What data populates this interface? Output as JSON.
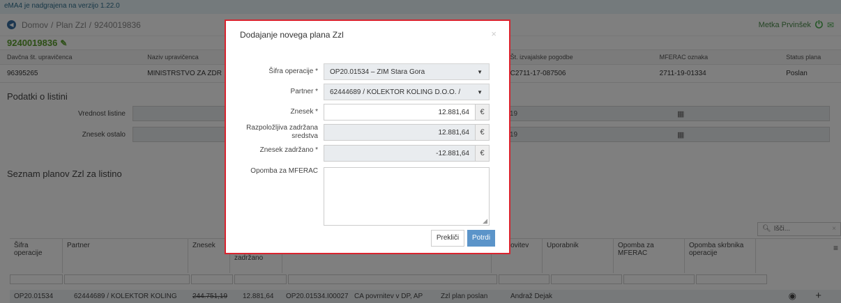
{
  "notice": "eMA4 je nadgrajena na verzijo 1.22.0",
  "breadcrumb": {
    "home": "Domov",
    "sep": "/",
    "plan": "Plan Zzl",
    "id": "9240019836"
  },
  "user": {
    "name": "Metka Prvinšek"
  },
  "document": {
    "number": "9240019836"
  },
  "info": {
    "headers": [
      "Davčna št. upravičenca",
      "Naziv upravičenca",
      "Št. izvajalske pogodbe",
      "MFERAC oznaka",
      "Status plana"
    ],
    "values": [
      "96395265",
      "MINISTRSTVO ZA ZDR",
      "C2711-17-087506",
      "2711-19-01334",
      "Poslan"
    ]
  },
  "listina": {
    "title": "Podatki o listini",
    "vrednost_label": "Vrednost listine",
    "ostalo_label": "Znesek ostalo",
    "partial_1": "19",
    "partial_2": "19"
  },
  "list": {
    "title": "Seznam planov Zzl za listino",
    "search_placeholder": "Išči...",
    "headers": [
      "Šifra operacije",
      "Partner",
      "Znesek",
      "zadržano",
      "Ugotovitev",
      "Uporabnik",
      "Opomba za MFERAC",
      "Opomba skrbnika operacije"
    ],
    "row": {
      "sifra": "OP20.01534",
      "partner": "62444689 / KOLEKTOR KOLING",
      "znesek": "244.751,19",
      "zadrzano": "12.881,64",
      "op": "OP20.01534.I00027",
      "vrsta": "CA povrnitev v DP, AP",
      "status": "Zzl plan poslan",
      "uporabnik": "Andraž Dejak"
    }
  },
  "modal": {
    "title": "Dodajanje novega plana Zzl",
    "fields": {
      "sifra_label": "Šifra operacije *",
      "sifra_value": "OP20.01534 – ZIM Stara Gora",
      "partner_label": "Partner *",
      "partner_value": "62444689 / KOLEKTOR KOLING D.O.O. /",
      "znesek_label": "Znesek *",
      "znesek_value": "12.881,64",
      "razpolozljiva_label": "Razpoložljiva zadržana sredstva",
      "razpolozljiva_value": "12.881,64",
      "zadrzano_label": "Znesek zadržano *",
      "zadrzano_value": "-12.881,64",
      "opomba_label": "Opomba za MFERAC",
      "currency": "€"
    },
    "cancel_label": "Prekliči",
    "confirm_label": "Potrdi"
  }
}
